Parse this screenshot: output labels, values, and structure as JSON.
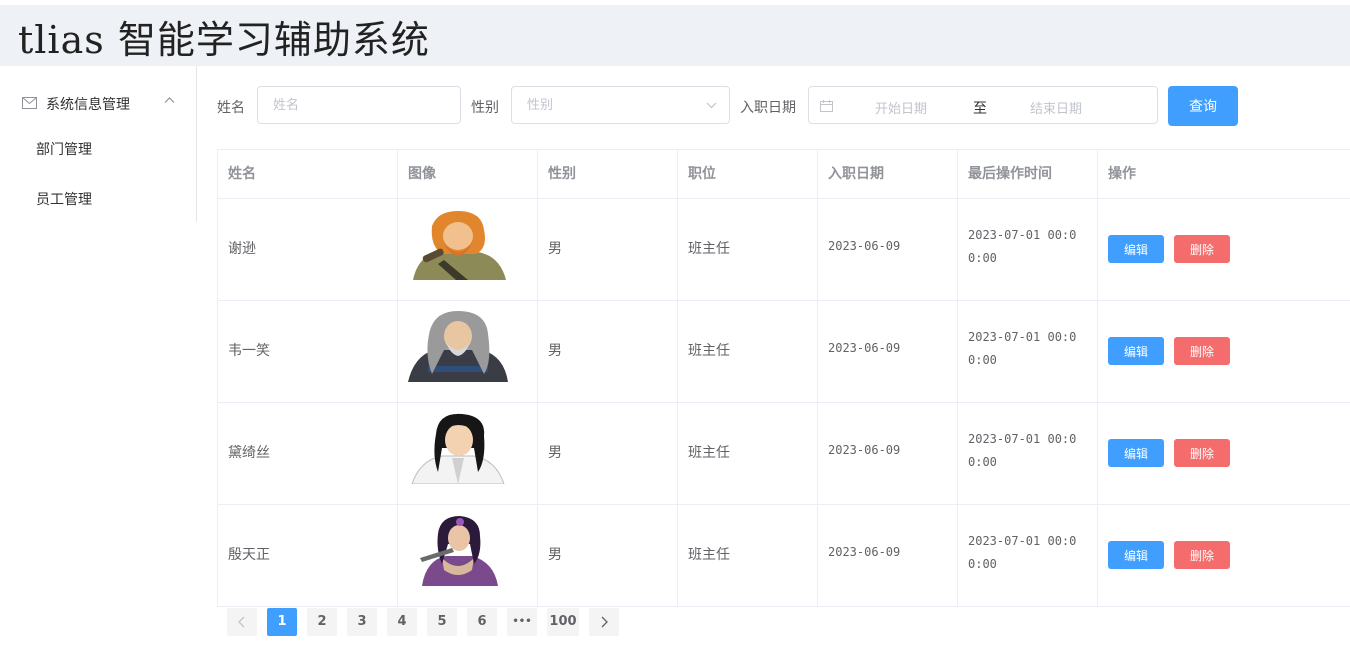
{
  "app": {
    "title": "tlias 智能学习辅助系统"
  },
  "sidebar": {
    "group_label": "系统信息管理",
    "items": [
      {
        "label": "部门管理"
      },
      {
        "label": "员工管理"
      }
    ]
  },
  "filters": {
    "name_label": "姓名",
    "name_placeholder": "姓名",
    "gender_label": "性别",
    "gender_placeholder": "性别",
    "date_label": "入职日期",
    "date_start_placeholder": "开始日期",
    "date_separator": "至",
    "date_end_placeholder": "结束日期",
    "query_label": "查询"
  },
  "table": {
    "columns": [
      "姓名",
      "图像",
      "性别",
      "职位",
      "入职日期",
      "最后操作时间",
      "操作"
    ],
    "rows": [
      {
        "name": "谢逊",
        "gender": "男",
        "position": "班主任",
        "entry_date": "2023-06-09",
        "time_line1": "2023-07-01 00:0",
        "time_line2": "0:00",
        "avatar": "elder-orange-hair-avatar"
      },
      {
        "name": "韦一笑",
        "gender": "男",
        "position": "班主任",
        "entry_date": "2023-06-09",
        "time_line1": "2023-07-01 00:0",
        "time_line2": "0:00",
        "avatar": "grey-hair-elder-avatar"
      },
      {
        "name": "黛绮丝",
        "gender": "男",
        "position": "班主任",
        "entry_date": "2023-06-09",
        "time_line1": "2023-07-01 00:0",
        "time_line2": "0:00",
        "avatar": "black-hair-young-man-avatar"
      },
      {
        "name": "殷天正",
        "gender": "男",
        "position": "班主任",
        "entry_date": "2023-06-09",
        "time_line1": "2023-07-01 00:0",
        "time_line2": "0:00",
        "avatar": "purple-warrior-woman-avatar"
      }
    ],
    "edit_label": "编辑",
    "delete_label": "删除"
  },
  "pagination": {
    "prev_icon": "chevron-left-icon",
    "next_icon": "chevron-right-icon",
    "pages": [
      "1",
      "2",
      "3",
      "4",
      "5",
      "6",
      "•••",
      "100"
    ],
    "current": "1"
  },
  "colors": {
    "primary": "#409eff",
    "danger": "#f56c6c",
    "header_bg": "#eef1f6"
  }
}
